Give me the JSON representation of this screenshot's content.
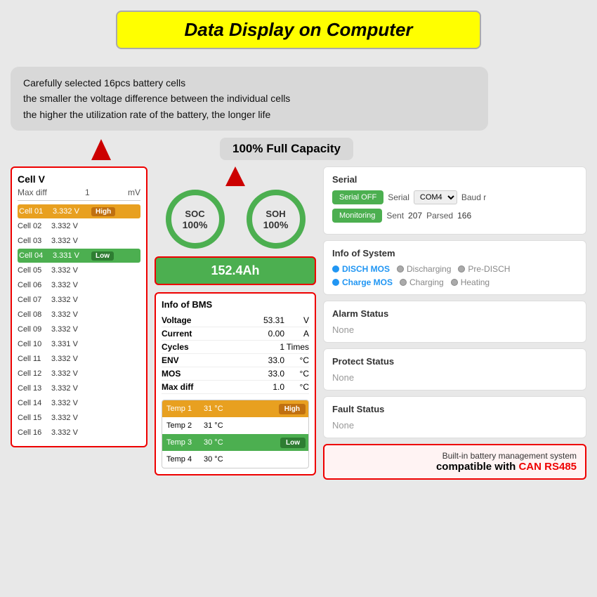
{
  "title": "Data Display on Computer",
  "description": {
    "line1": "Carefully selected 16pcs battery cells",
    "line2": "the smaller the voltage difference between the individual cells",
    "line3": "the higher the utilization rate of the battery, the longer life"
  },
  "capacity_label": "100% Full Capacity",
  "cell_panel": {
    "title": "Cell V",
    "max_diff_label": "Max diff",
    "max_diff_value": "1",
    "max_diff_unit": "mV",
    "cells": [
      {
        "name": "Cell 01",
        "value": "3.332 V",
        "badge": "High",
        "highlight": "orange"
      },
      {
        "name": "Cell 02",
        "value": "3.332 V",
        "badge": "",
        "highlight": "none"
      },
      {
        "name": "Cell 03",
        "value": "3.332 V",
        "badge": "",
        "highlight": "none"
      },
      {
        "name": "Cell 04",
        "value": "3.331 V",
        "badge": "Low",
        "highlight": "green"
      },
      {
        "name": "Cell 05",
        "value": "3.332 V",
        "badge": "",
        "highlight": "none"
      },
      {
        "name": "Cell 06",
        "value": "3.332 V",
        "badge": "",
        "highlight": "none"
      },
      {
        "name": "Cell 07",
        "value": "3.332 V",
        "badge": "",
        "highlight": "none"
      },
      {
        "name": "Cell 08",
        "value": "3.332 V",
        "badge": "",
        "highlight": "none"
      },
      {
        "name": "Cell 09",
        "value": "3.332 V",
        "badge": "",
        "highlight": "none"
      },
      {
        "name": "Cell 10",
        "value": "3.331 V",
        "badge": "",
        "highlight": "none"
      },
      {
        "name": "Cell 11",
        "value": "3.332 V",
        "badge": "",
        "highlight": "none"
      },
      {
        "name": "Cell 12",
        "value": "3.332 V",
        "badge": "",
        "highlight": "none"
      },
      {
        "name": "Cell 13",
        "value": "3.332 V",
        "badge": "",
        "highlight": "none"
      },
      {
        "name": "Cell 14",
        "value": "3.332 V",
        "badge": "",
        "highlight": "none"
      },
      {
        "name": "Cell 15",
        "value": "3.332 V",
        "badge": "",
        "highlight": "none"
      },
      {
        "name": "Cell 16",
        "value": "3.332 V",
        "badge": "",
        "highlight": "none"
      }
    ]
  },
  "gauges": {
    "soc": {
      "label": "SOC",
      "value": "100%"
    },
    "soh": {
      "label": "SOH",
      "value": "100%"
    }
  },
  "capacity_bar": "152.4Ah",
  "bms": {
    "title": "Info of BMS",
    "rows": [
      {
        "key": "Voltage",
        "value": "53.31",
        "unit": "V"
      },
      {
        "key": "Current",
        "value": "0.00",
        "unit": "A"
      },
      {
        "key": "Cycles",
        "value": "1",
        "unit": "Times"
      },
      {
        "key": "ENV",
        "value": "33.0",
        "unit": "°C"
      },
      {
        "key": "MOS",
        "value": "33.0",
        "unit": "°C"
      },
      {
        "key": "Max diff",
        "value": "1.0",
        "unit": "°C"
      }
    ],
    "temps": [
      {
        "name": "Temp 1",
        "value": "31 °C",
        "badge": "High",
        "highlight": "orange"
      },
      {
        "name": "Temp 2",
        "value": "31 °C",
        "badge": "",
        "highlight": "none"
      },
      {
        "name": "Temp 3",
        "value": "30 °C",
        "badge": "Low",
        "highlight": "green"
      },
      {
        "name": "Temp 4",
        "value": "30 °C",
        "badge": "",
        "highlight": "none"
      }
    ]
  },
  "serial": {
    "title": "Serial",
    "btn_off": "Serial OFF",
    "btn_monitoring": "Monitoring",
    "serial_label": "Serial",
    "serial_value": "COM4",
    "baud_label": "Baud r",
    "sent_label": "Sent",
    "sent_value": "207",
    "parsed_label": "Parsed",
    "parsed_value": "166"
  },
  "info_system": {
    "title": "Info of System",
    "items": [
      {
        "label": "DISCH MOS",
        "dot": "blue",
        "sub_label": "Discharging",
        "sub_dot": "gray"
      },
      {
        "label": "Charge MOS",
        "dot": "blue",
        "sub_label": "Charging",
        "sub_dot": "gray"
      },
      {
        "extra_label": "Pre-DISCH",
        "extra_dot": "gray"
      },
      {
        "extra_label": "Heating",
        "extra_dot": "gray"
      }
    ]
  },
  "alarm_status": {
    "title": "Alarm Status",
    "value": "None"
  },
  "protect_status": {
    "title": "Protect Status",
    "value": "None"
  },
  "fault_status": {
    "title": "Fault Status",
    "value": "None"
  },
  "bottom_note": {
    "line1": "Built-in battery management system",
    "line2_pre": "compatible with ",
    "line2_highlight": "CAN RS485"
  }
}
